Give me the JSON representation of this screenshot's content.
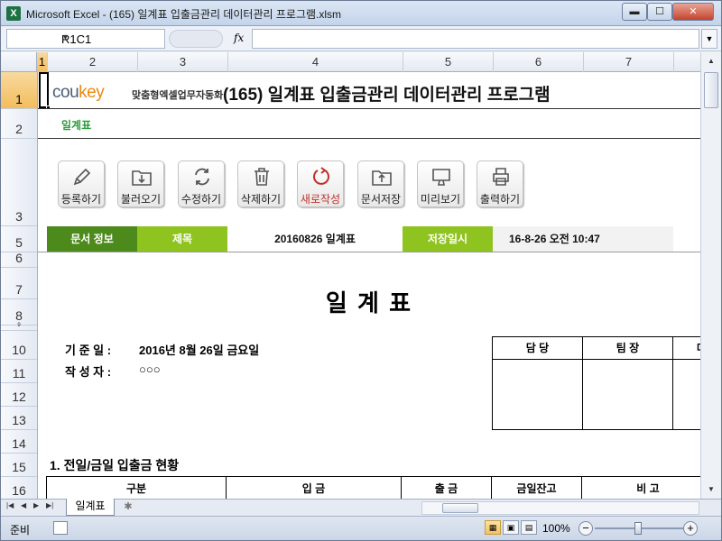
{
  "window": {
    "title": "Microsoft Excel - (165) 일계표 입출금관리 데이터관리 프로그램.xlsm",
    "app_icon": "X",
    "minimize": "▬",
    "maximize": "☐",
    "close": "✕"
  },
  "formula_bar": {
    "name_box": "R1C1",
    "fx_label": "fx",
    "formula": ""
  },
  "columns": [
    "1",
    "2",
    "3",
    "4",
    "5",
    "6",
    "7"
  ],
  "rows": [
    "1",
    "2",
    "3",
    "5",
    "6",
    "7",
    "8",
    "9",
    "10",
    "11",
    "12",
    "13",
    "14",
    "15",
    "16"
  ],
  "header": {
    "logo_main": "cou",
    "logo_accent": "key",
    "logo_sub": "맞춤형엑셀업무자동화",
    "title": "(165) 일계표 입출금관리 데이터관리 프로그램",
    "subtitle": "일계표"
  },
  "toolbar": [
    {
      "label": "등록하기",
      "icon": "pencil-icon"
    },
    {
      "label": "불러오기",
      "icon": "folder-import-icon"
    },
    {
      "label": "수정하기",
      "icon": "refresh-icon"
    },
    {
      "label": "삭제하기",
      "icon": "trash-icon"
    },
    {
      "label": "새로작성",
      "icon": "new-circle-icon"
    },
    {
      "label": "문서저장",
      "icon": "folder-export-icon"
    },
    {
      "label": "미리보기",
      "icon": "monitor-icon"
    },
    {
      "label": "출력하기",
      "icon": "printer-icon"
    }
  ],
  "info": {
    "doc_info_label": "문서 정보",
    "subject_label": "제목",
    "subject_value": "20160826 일계표",
    "saved_label": "저장일시",
    "saved_value": "16-8-26 오전 10:47"
  },
  "report": {
    "title": "일  계  표",
    "date_label": "기 준 일 :",
    "date_value": "2016년 8월 26일 금요일",
    "author_label": "작 성 자 :",
    "author_value": "○○○",
    "approval_headers": [
      "담  당",
      "팀  장",
      "대"
    ],
    "section_title": "1. 전일/금일 입출금 현황",
    "table_headers": [
      "구분",
      "입      금",
      "출      금",
      "금일잔고",
      "비      고"
    ]
  },
  "sheet_tabs": {
    "active": "일계표"
  },
  "status": {
    "ready": "준비",
    "zoom": "100%",
    "zoom_level": 1.0
  }
}
